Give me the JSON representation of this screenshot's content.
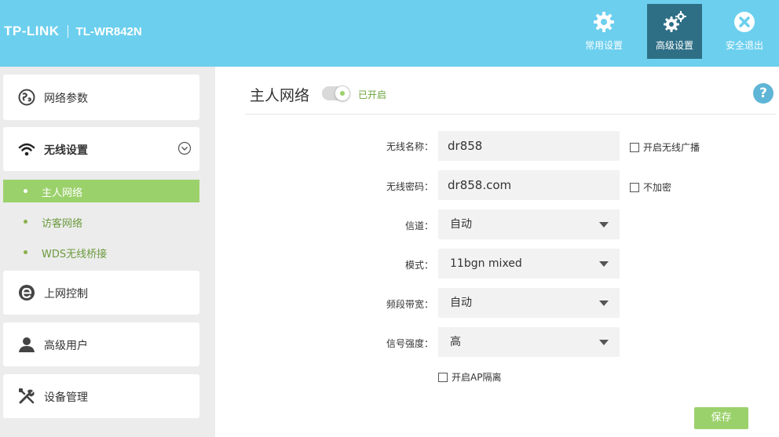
{
  "header": {
    "brand": "TP-LINK",
    "model": "TL-WR842N",
    "nav": [
      {
        "label": "常用设置",
        "icon": "gear-icon"
      },
      {
        "label": "高级设置",
        "icon": "gears-icon"
      },
      {
        "label": "安全退出",
        "icon": "close-circle-icon"
      }
    ]
  },
  "sidebar": {
    "items": [
      {
        "label": "网络参数",
        "icon": "globe-icon"
      },
      {
        "label": "无线设置",
        "icon": "wifi-icon",
        "expanded": true
      },
      {
        "label": "上网控制",
        "icon": "ie-icon"
      },
      {
        "label": "高级用户",
        "icon": "user-icon"
      },
      {
        "label": "设备管理",
        "icon": "tools-icon"
      }
    ],
    "subitems": [
      {
        "label": "主人网络",
        "active": true
      },
      {
        "label": "访客网络",
        "active": false
      },
      {
        "label": "WDS无线桥接",
        "active": false
      }
    ]
  },
  "main": {
    "title": "主人网络",
    "toggle_status": "已开启",
    "help": "?",
    "fields": {
      "ssid_label": "无线名称：",
      "ssid_value": "dr858",
      "password_label": "无线密码：",
      "password_value": "dr858.com",
      "channel_label": "信道：",
      "channel_value": "自动",
      "mode_label": "模式：",
      "mode_value": "11bgn mixed",
      "bandwidth_label": "频段带宽：",
      "bandwidth_value": "自动",
      "signal_label": "信号强度：",
      "signal_value": "高"
    },
    "checkboxes": {
      "broadcast": "开启无线广播",
      "no_encrypt": "不加密",
      "ap_isolation": "开启AP隔离"
    },
    "save_label": "保存"
  },
  "colors": {
    "header": "#6ccfee",
    "header_active": "#2e6f86",
    "accent_green": "#9bd16b",
    "sidebar_bg": "#ececec"
  }
}
